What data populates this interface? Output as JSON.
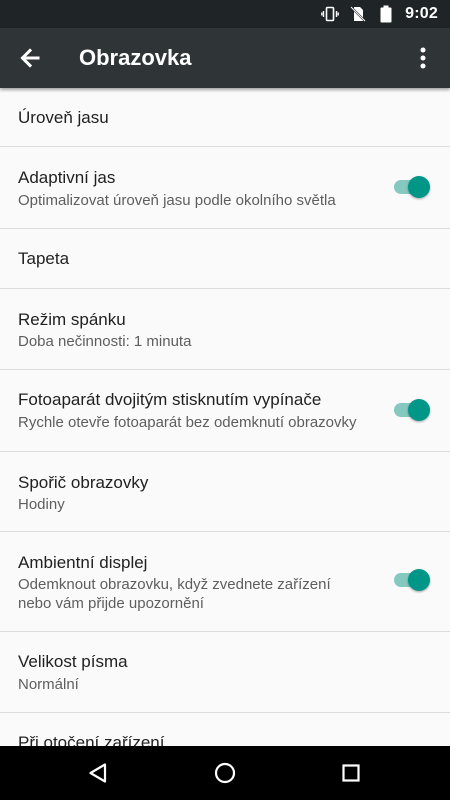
{
  "status_bar": {
    "time": "9:02"
  },
  "app_bar": {
    "title": "Obrazovka"
  },
  "settings": [
    {
      "title": "Úroveň jasu"
    },
    {
      "title": "Adaptivní jas",
      "subtitle": "Optimalizovat úroveň jasu podle okolního světla",
      "toggle": true
    },
    {
      "title": "Tapeta"
    },
    {
      "title": "Režim spánku",
      "subtitle": "Doba nečinnosti: 1 minuta"
    },
    {
      "title": "Fotoaparát dvojitým stisknutím vypínače",
      "subtitle": "Rychle otevře fotoaparát bez odemknutí obrazovky",
      "toggle": true
    },
    {
      "title": "Spořič obrazovky",
      "subtitle": "Hodiny"
    },
    {
      "title": "Ambientní displej",
      "subtitle": "Odemknout obrazovku, když zvednete zařízení",
      "subtitle2": "nebo vám přijde upozornění",
      "toggle": true
    },
    {
      "title": "Velikost písma",
      "subtitle": "Normální"
    },
    {
      "title": "Při otočení zařízení"
    }
  ],
  "colors": {
    "accent": "#009688",
    "accent_track": "#85c8bf",
    "app_bar": "#2f3537",
    "status_bar": "#1f2426",
    "background": "#fafafa"
  },
  "icons": {
    "status": [
      "vibrate-icon",
      "no-sim-icon",
      "battery-icon"
    ],
    "app_bar": [
      "back-arrow-icon",
      "overflow-menu-icon"
    ],
    "nav": [
      "back-triangle-icon",
      "home-circle-icon",
      "recents-square-icon"
    ]
  }
}
